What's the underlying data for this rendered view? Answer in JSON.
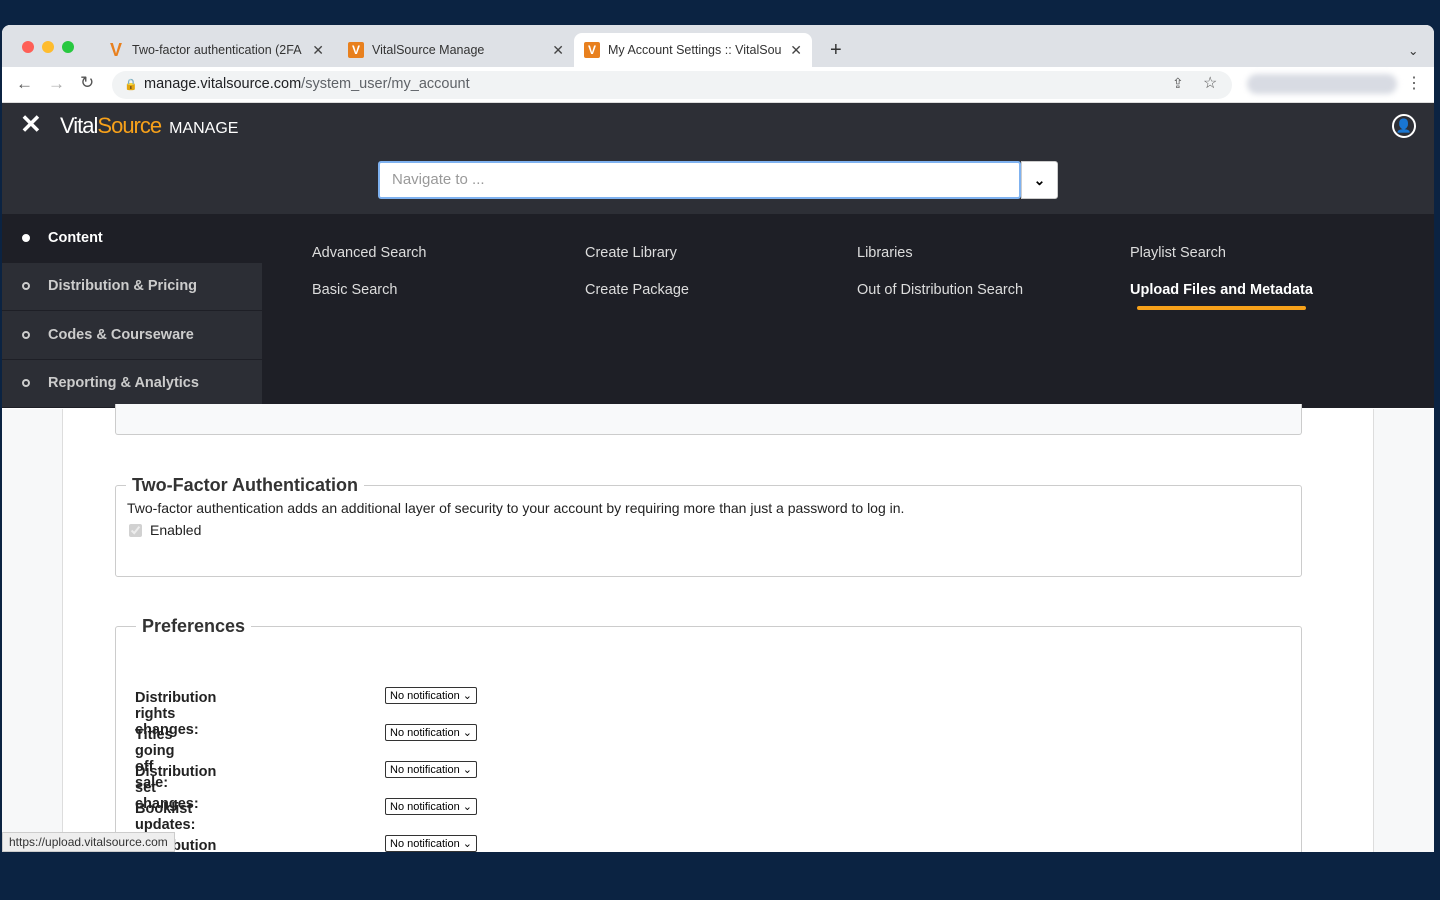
{
  "browser": {
    "tabs": [
      {
        "title": "Two-factor authentication (2FA",
        "favicon": "V"
      },
      {
        "title": "VitalSource Manage",
        "favicon": "V"
      },
      {
        "title": "My Account Settings :: VitalSou",
        "favicon": "V"
      }
    ],
    "url_host": "manage.vitalsource.com",
    "url_path": "/system_user/my_account",
    "status_url": "https://upload.vitalsource.com"
  },
  "header": {
    "brand_a": "Vital",
    "brand_b": "Source",
    "brand_c": "MANAGE",
    "nav_placeholder": "Navigate to ..."
  },
  "sidebar": [
    {
      "label": "Content",
      "active": true
    },
    {
      "label": "Distribution & Pricing"
    },
    {
      "label": "Codes & Courseware"
    },
    {
      "label": "Reporting & Analytics"
    }
  ],
  "menu_links": [
    "Advanced Search",
    "Basic Search",
    "Create Library",
    "Create Package",
    "Libraries",
    "Out of Distribution Search",
    "Playlist Search",
    "Upload Files and Metadata"
  ],
  "twofa": {
    "title": "Two-Factor Authentication",
    "desc": "Two-factor authentication adds an additional layer of security to your account by requiring more than just a password to log in.",
    "enabled_label": "Enabled",
    "enabled": true
  },
  "preferences": {
    "title": "Preferences",
    "rows": [
      {
        "label": "Distribution rights changes:",
        "value": "No notification"
      },
      {
        "label": "Titles going off sale:",
        "value": "No notification"
      },
      {
        "label": "Distribution set changes:",
        "value": "No notification"
      },
      {
        "label": "Booklist updates:",
        "value": "No notification"
      },
      {
        "label": "Distribution requests:",
        "value": "No notification"
      }
    ]
  },
  "colors": {
    "accent": "#f7a11a",
    "header": "#2d2f36",
    "menu": "#1e1f26"
  }
}
